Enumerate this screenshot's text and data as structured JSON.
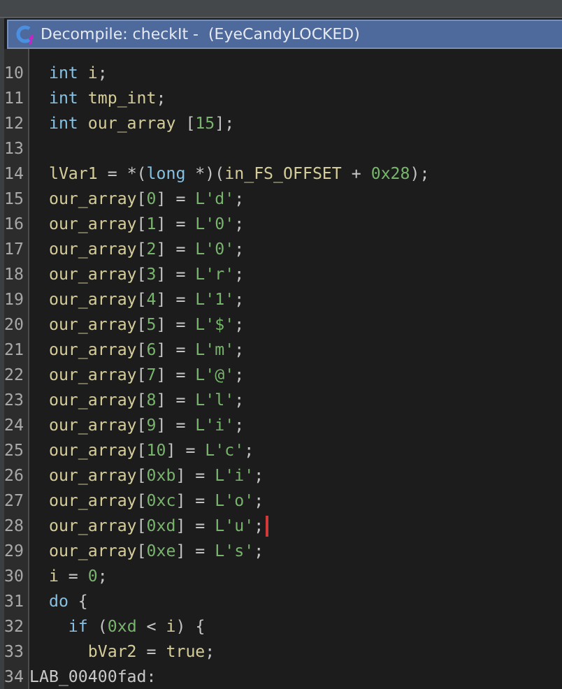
{
  "window": {
    "title": "Decompile: checkIt -  (EyeCandyLOCKED)"
  },
  "lines": [
    {
      "number": "10",
      "has_cursor": false,
      "tokens": [
        {
          "kind": "keyword",
          "text": "  int"
        },
        {
          "kind": "ident",
          "text": " i"
        },
        {
          "kind": "punct",
          "text": ";"
        }
      ]
    },
    {
      "number": "11",
      "has_cursor": false,
      "tokens": [
        {
          "kind": "keyword",
          "text": "  int"
        },
        {
          "kind": "ident",
          "text": " tmp_int"
        },
        {
          "kind": "punct",
          "text": ";"
        }
      ]
    },
    {
      "number": "12",
      "has_cursor": false,
      "tokens": [
        {
          "kind": "keyword",
          "text": "  int"
        },
        {
          "kind": "ident",
          "text": " our_array "
        },
        {
          "kind": "punct",
          "text": "["
        },
        {
          "kind": "number",
          "text": "15"
        },
        {
          "kind": "punct",
          "text": "];"
        }
      ]
    },
    {
      "number": "13",
      "has_cursor": false
    },
    {
      "number": "14",
      "has_cursor": false,
      "tokens": [
        {
          "kind": "ident",
          "text": "  lVar1"
        },
        {
          "kind": "punct",
          "text": " = *("
        },
        {
          "kind": "keyword",
          "text": "long"
        },
        {
          "kind": "punct",
          "text": " *)("
        },
        {
          "kind": "ident",
          "text": "in_FS_OFFSET"
        },
        {
          "kind": "punct",
          "text": " + "
        },
        {
          "kind": "number",
          "text": "0x28"
        },
        {
          "kind": "punct",
          "text": ");"
        }
      ]
    },
    {
      "number": "15",
      "has_cursor": false,
      "tokens": [
        {
          "kind": "ident",
          "text": "  our_array"
        },
        {
          "kind": "punct",
          "text": "["
        },
        {
          "kind": "number",
          "text": "0"
        },
        {
          "kind": "punct",
          "text": "] = "
        },
        {
          "kind": "number",
          "text": "L'd'"
        },
        {
          "kind": "punct",
          "text": ";"
        }
      ]
    },
    {
      "number": "16",
      "has_cursor": false,
      "tokens": [
        {
          "kind": "ident",
          "text": "  our_array"
        },
        {
          "kind": "punct",
          "text": "["
        },
        {
          "kind": "number",
          "text": "1"
        },
        {
          "kind": "punct",
          "text": "] = "
        },
        {
          "kind": "number",
          "text": "L'0'"
        },
        {
          "kind": "punct",
          "text": ";"
        }
      ]
    },
    {
      "number": "17",
      "has_cursor": false,
      "tokens": [
        {
          "kind": "ident",
          "text": "  our_array"
        },
        {
          "kind": "punct",
          "text": "["
        },
        {
          "kind": "number",
          "text": "2"
        },
        {
          "kind": "punct",
          "text": "] = "
        },
        {
          "kind": "number",
          "text": "L'0'"
        },
        {
          "kind": "punct",
          "text": ";"
        }
      ]
    },
    {
      "number": "18",
      "has_cursor": false,
      "tokens": [
        {
          "kind": "ident",
          "text": "  our_array"
        },
        {
          "kind": "punct",
          "text": "["
        },
        {
          "kind": "number",
          "text": "3"
        },
        {
          "kind": "punct",
          "text": "] = "
        },
        {
          "kind": "number",
          "text": "L'r'"
        },
        {
          "kind": "punct",
          "text": ";"
        }
      ]
    },
    {
      "number": "19",
      "has_cursor": false,
      "tokens": [
        {
          "kind": "ident",
          "text": "  our_array"
        },
        {
          "kind": "punct",
          "text": "["
        },
        {
          "kind": "number",
          "text": "4"
        },
        {
          "kind": "punct",
          "text": "] = "
        },
        {
          "kind": "number",
          "text": "L'1'"
        },
        {
          "kind": "punct",
          "text": ";"
        }
      ]
    },
    {
      "number": "20",
      "has_cursor": false,
      "tokens": [
        {
          "kind": "ident",
          "text": "  our_array"
        },
        {
          "kind": "punct",
          "text": "["
        },
        {
          "kind": "number",
          "text": "5"
        },
        {
          "kind": "punct",
          "text": "] = "
        },
        {
          "kind": "number",
          "text": "L'$'"
        },
        {
          "kind": "punct",
          "text": ";"
        }
      ]
    },
    {
      "number": "21",
      "has_cursor": false,
      "tokens": [
        {
          "kind": "ident",
          "text": "  our_array"
        },
        {
          "kind": "punct",
          "text": "["
        },
        {
          "kind": "number",
          "text": "6"
        },
        {
          "kind": "punct",
          "text": "] = "
        },
        {
          "kind": "number",
          "text": "L'm'"
        },
        {
          "kind": "punct",
          "text": ";"
        }
      ]
    },
    {
      "number": "22",
      "has_cursor": false,
      "tokens": [
        {
          "kind": "ident",
          "text": "  our_array"
        },
        {
          "kind": "punct",
          "text": "["
        },
        {
          "kind": "number",
          "text": "7"
        },
        {
          "kind": "punct",
          "text": "] = "
        },
        {
          "kind": "number",
          "text": "L'@'"
        },
        {
          "kind": "punct",
          "text": ";"
        }
      ]
    },
    {
      "number": "23",
      "has_cursor": false,
      "tokens": [
        {
          "kind": "ident",
          "text": "  our_array"
        },
        {
          "kind": "punct",
          "text": "["
        },
        {
          "kind": "number",
          "text": "8"
        },
        {
          "kind": "punct",
          "text": "] = "
        },
        {
          "kind": "number",
          "text": "L'l'"
        },
        {
          "kind": "punct",
          "text": ";"
        }
      ]
    },
    {
      "number": "24",
      "has_cursor": false,
      "tokens": [
        {
          "kind": "ident",
          "text": "  our_array"
        },
        {
          "kind": "punct",
          "text": "["
        },
        {
          "kind": "number",
          "text": "9"
        },
        {
          "kind": "punct",
          "text": "] = "
        },
        {
          "kind": "number",
          "text": "L'i'"
        },
        {
          "kind": "punct",
          "text": ";"
        }
      ]
    },
    {
      "number": "25",
      "has_cursor": false,
      "tokens": [
        {
          "kind": "ident",
          "text": "  our_array"
        },
        {
          "kind": "punct",
          "text": "["
        },
        {
          "kind": "number",
          "text": "10"
        },
        {
          "kind": "punct",
          "text": "] = "
        },
        {
          "kind": "number",
          "text": "L'c'"
        },
        {
          "kind": "punct",
          "text": ";"
        }
      ]
    },
    {
      "number": "26",
      "has_cursor": false,
      "tokens": [
        {
          "kind": "ident",
          "text": "  our_array"
        },
        {
          "kind": "punct",
          "text": "["
        },
        {
          "kind": "number",
          "text": "0xb"
        },
        {
          "kind": "punct",
          "text": "] = "
        },
        {
          "kind": "number",
          "text": "L'i'"
        },
        {
          "kind": "punct",
          "text": ";"
        }
      ]
    },
    {
      "number": "27",
      "has_cursor": false,
      "tokens": [
        {
          "kind": "ident",
          "text": "  our_array"
        },
        {
          "kind": "punct",
          "text": "["
        },
        {
          "kind": "number",
          "text": "0xc"
        },
        {
          "kind": "punct",
          "text": "] = "
        },
        {
          "kind": "number",
          "text": "L'o'"
        },
        {
          "kind": "punct",
          "text": ";"
        }
      ]
    },
    {
      "number": "28",
      "has_cursor": true,
      "tokens": [
        {
          "kind": "ident",
          "text": "  our_array"
        },
        {
          "kind": "punct",
          "text": "["
        },
        {
          "kind": "number",
          "text": "0xd"
        },
        {
          "kind": "punct",
          "text": "] = "
        },
        {
          "kind": "number",
          "text": "L'u'"
        },
        {
          "kind": "punct",
          "text": ";"
        }
      ]
    },
    {
      "number": "29",
      "has_cursor": false,
      "tokens": [
        {
          "kind": "ident",
          "text": "  our_array"
        },
        {
          "kind": "punct",
          "text": "["
        },
        {
          "kind": "number",
          "text": "0xe"
        },
        {
          "kind": "punct",
          "text": "] = "
        },
        {
          "kind": "number",
          "text": "L's'"
        },
        {
          "kind": "punct",
          "text": ";"
        }
      ]
    },
    {
      "number": "30",
      "has_cursor": false,
      "tokens": [
        {
          "kind": "ident",
          "text": "  i"
        },
        {
          "kind": "punct",
          "text": " = "
        },
        {
          "kind": "number",
          "text": "0"
        },
        {
          "kind": "punct",
          "text": ";"
        }
      ]
    },
    {
      "number": "31",
      "has_cursor": false,
      "tokens": [
        {
          "kind": "keyword",
          "text": "  do"
        },
        {
          "kind": "punct",
          "text": " {"
        }
      ]
    },
    {
      "number": "32",
      "has_cursor": false,
      "tokens": [
        {
          "kind": "keyword",
          "text": "    if"
        },
        {
          "kind": "punct",
          "text": " ("
        },
        {
          "kind": "number",
          "text": "0xd"
        },
        {
          "kind": "punct",
          "text": " < "
        },
        {
          "kind": "ident",
          "text": "i"
        },
        {
          "kind": "punct",
          "text": ") {"
        }
      ]
    },
    {
      "number": "33",
      "has_cursor": false,
      "tokens": [
        {
          "kind": "ident",
          "text": "      bVar2"
        },
        {
          "kind": "punct",
          "text": " = "
        },
        {
          "kind": "ident",
          "text": "true"
        },
        {
          "kind": "punct",
          "text": ";"
        }
      ]
    },
    {
      "number": "34",
      "has_cursor": false,
      "tokens": [
        {
          "kind": "label",
          "text": "LAB_00400fad"
        },
        {
          "kind": "punct",
          "text": ":"
        }
      ]
    }
  ]
}
